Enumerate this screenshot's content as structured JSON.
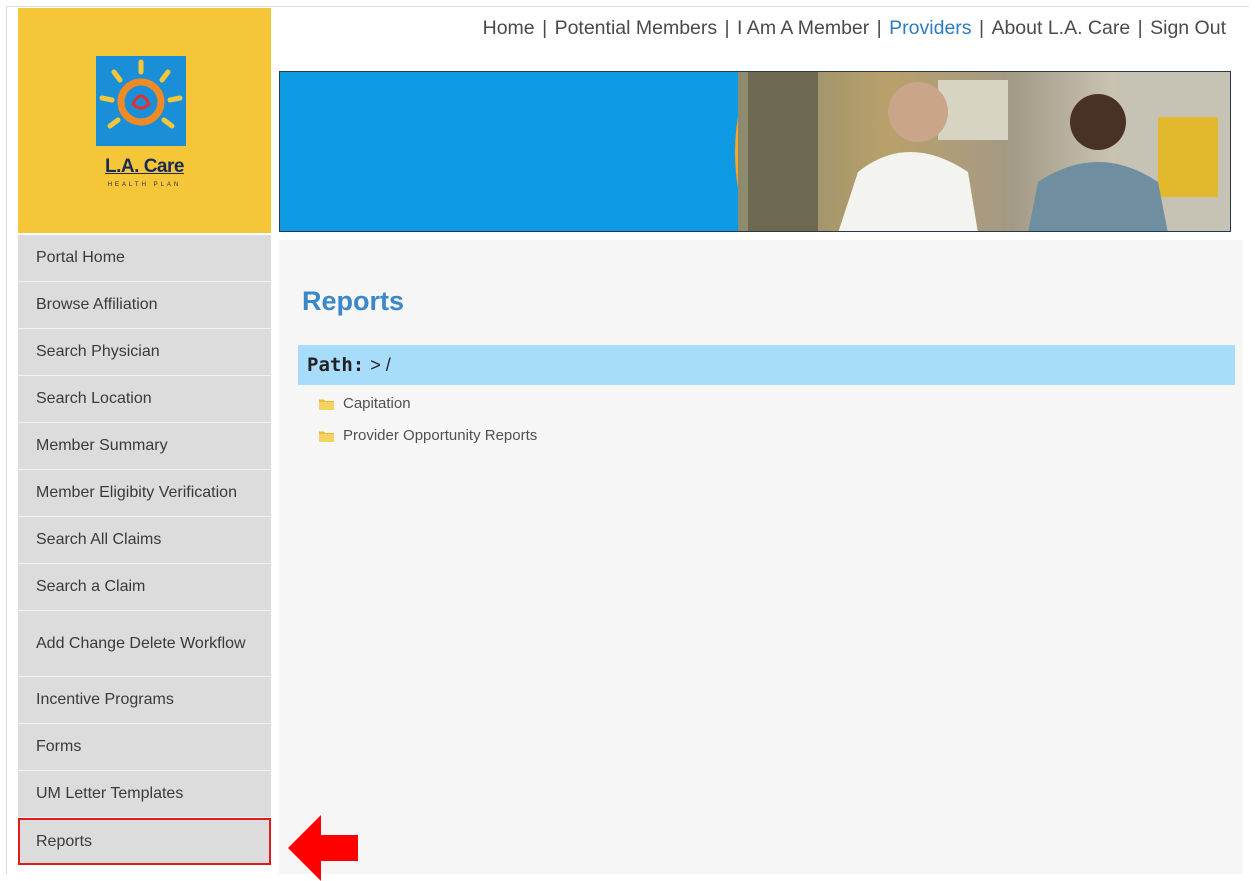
{
  "logo": {
    "name": "L.A. Care",
    "tagline": "HEALTH PLAN"
  },
  "topnav": [
    {
      "label": "Home",
      "current": false
    },
    {
      "label": "Potential Members",
      "current": false
    },
    {
      "label": "I Am A Member",
      "current": false
    },
    {
      "label": "Providers",
      "current": true
    },
    {
      "label": "About L.A. Care",
      "current": false
    },
    {
      "label": "Sign Out",
      "current": false
    }
  ],
  "sidebar": {
    "items": [
      {
        "label": "Portal Home"
      },
      {
        "label": "Browse Affiliation"
      },
      {
        "label": "Search Physician"
      },
      {
        "label": "Search Location"
      },
      {
        "label": "Member Summary"
      },
      {
        "label": "Member Eligibity Verification"
      },
      {
        "label": "Search All Claims"
      },
      {
        "label": "Search a Claim"
      },
      {
        "label": "Add Change Delete Workflow"
      },
      {
        "label": "Incentive Programs"
      },
      {
        "label": "Forms"
      },
      {
        "label": "UM Letter Templates"
      },
      {
        "label": "Reports",
        "active": true
      }
    ]
  },
  "main": {
    "title": "Reports",
    "path_label": "Path:",
    "path_value": "> /",
    "folders": [
      {
        "label": "Capitation",
        "icon": "folder-icon"
      },
      {
        "label": "Provider Opportunity Reports",
        "icon": "folder-icon"
      }
    ]
  },
  "colors": {
    "logo_bg": "#f5c638",
    "title": "#3a88c9",
    "path_bar": "#a8dcfb",
    "highlight": "#e01b1b"
  }
}
